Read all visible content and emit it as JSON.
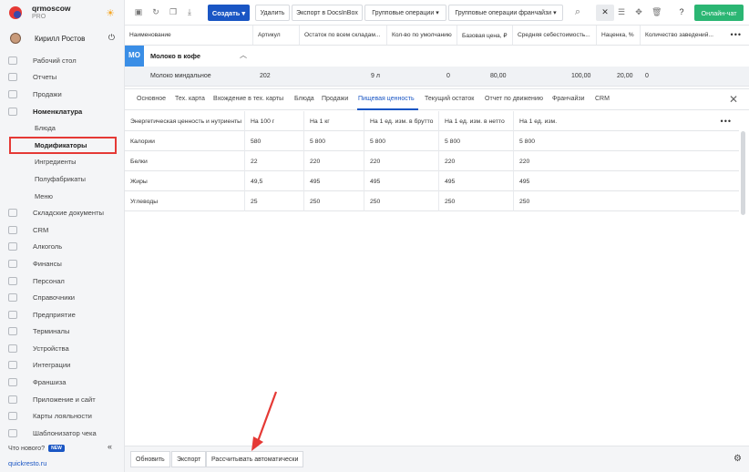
{
  "brand": {
    "name": "qrmoscow",
    "plan": "PRO"
  },
  "user": {
    "name": "Кирилл Ростов"
  },
  "sidebar": {
    "items": [
      {
        "label": "Рабочий стол",
        "icon": "desktop-icon"
      },
      {
        "label": "Отчеты",
        "icon": "chart-icon"
      },
      {
        "label": "Продажи",
        "icon": "cart-icon"
      },
      {
        "label": "Номенклатура",
        "icon": "tag-icon",
        "active": true
      },
      {
        "label": "Складские документы",
        "icon": "document-icon"
      },
      {
        "label": "CRM",
        "icon": "crm-icon"
      },
      {
        "label": "Алкоголь",
        "icon": "glass-icon"
      },
      {
        "label": "Финансы",
        "icon": "wallet-icon"
      },
      {
        "label": "Персонал",
        "icon": "people-icon"
      },
      {
        "label": "Справочники",
        "icon": "book-icon"
      },
      {
        "label": "Предприятие",
        "icon": "building-icon"
      },
      {
        "label": "Терминалы",
        "icon": "terminal-icon"
      },
      {
        "label": "Устройства",
        "icon": "device-icon"
      },
      {
        "label": "Интеграции",
        "icon": "link-icon"
      },
      {
        "label": "Франшиза",
        "icon": "franchise-icon"
      },
      {
        "label": "Приложение и сайт",
        "icon": "app-icon"
      },
      {
        "label": "Карты лояльности",
        "icon": "card-icon"
      },
      {
        "label": "Шаблонизатор чека",
        "icon": "receipt-icon"
      }
    ],
    "sub_items": [
      "Блюда",
      "Модификаторы",
      "Ингредиенты",
      "Полуфабрикаты",
      "Меню"
    ],
    "selected_sub": "Модификаторы",
    "whats_new": "Что нового?",
    "new_badge": "NEW",
    "collapse": "«",
    "domain": "quickresto.ru"
  },
  "toolbar": {
    "create": "Создать ▾",
    "delete": "Удалить",
    "export_docsinbox": "Экспорт в DocsInBox",
    "group_ops": "Групповые операции ▾",
    "group_ops_franchise": "Групповые операции франчайзи ▾",
    "online_chat": "Онлайн-чат"
  },
  "top_table": {
    "headers": [
      "Наименование",
      "Артикул",
      "Остаток по всем складам...",
      "Кол-во по умолчанию",
      "Базовая цена, ₽",
      "Средняя себестоимость...",
      "Наценка, %",
      "Количество заведений..."
    ],
    "group": {
      "badge": "МО",
      "name": "Молоко в кофе"
    },
    "row": {
      "name": "Молоко миндальное",
      "article": "202",
      "stock": "9 л",
      "default_qty": "0",
      "base_price": "80,00",
      "avg_cost": "100,00",
      "markup": "20,00",
      "venues": "0"
    }
  },
  "tabs": {
    "items": [
      "Основное",
      "Тех. карта",
      "Вхождение в тех. карты",
      "Блюда",
      "Продажи",
      "Пищевая ценность",
      "Текущий остаток",
      "Отчет по движению",
      "Франчайзи",
      "CRM"
    ],
    "active": "Пищевая ценность"
  },
  "nutrition": {
    "headers": [
      "Энергетическая ценность и нутриенты",
      "На 100 г",
      "На 1 кг",
      "На 1 ед. изм. в брутто",
      "На 1 ед. изм. в нетто",
      "На 1 ед. изм."
    ],
    "rows": [
      [
        "Калории",
        "580",
        "5 800",
        "5 800",
        "5 800",
        "5 800"
      ],
      [
        "Белки",
        "22",
        "220",
        "220",
        "220",
        "220"
      ],
      [
        "Жиры",
        "49,5",
        "495",
        "495",
        "495",
        "495"
      ],
      [
        "Углеводы",
        "25",
        "250",
        "250",
        "250",
        "250"
      ]
    ]
  },
  "bottom": {
    "refresh": "Обновить",
    "export": "Экспорт",
    "auto_calc": "Рассчитывать автоматически"
  },
  "colors": {
    "accent": "#1a56c4",
    "chat": "#2bb673",
    "highlight": "#e53935",
    "badge": "#3a8ee6"
  }
}
